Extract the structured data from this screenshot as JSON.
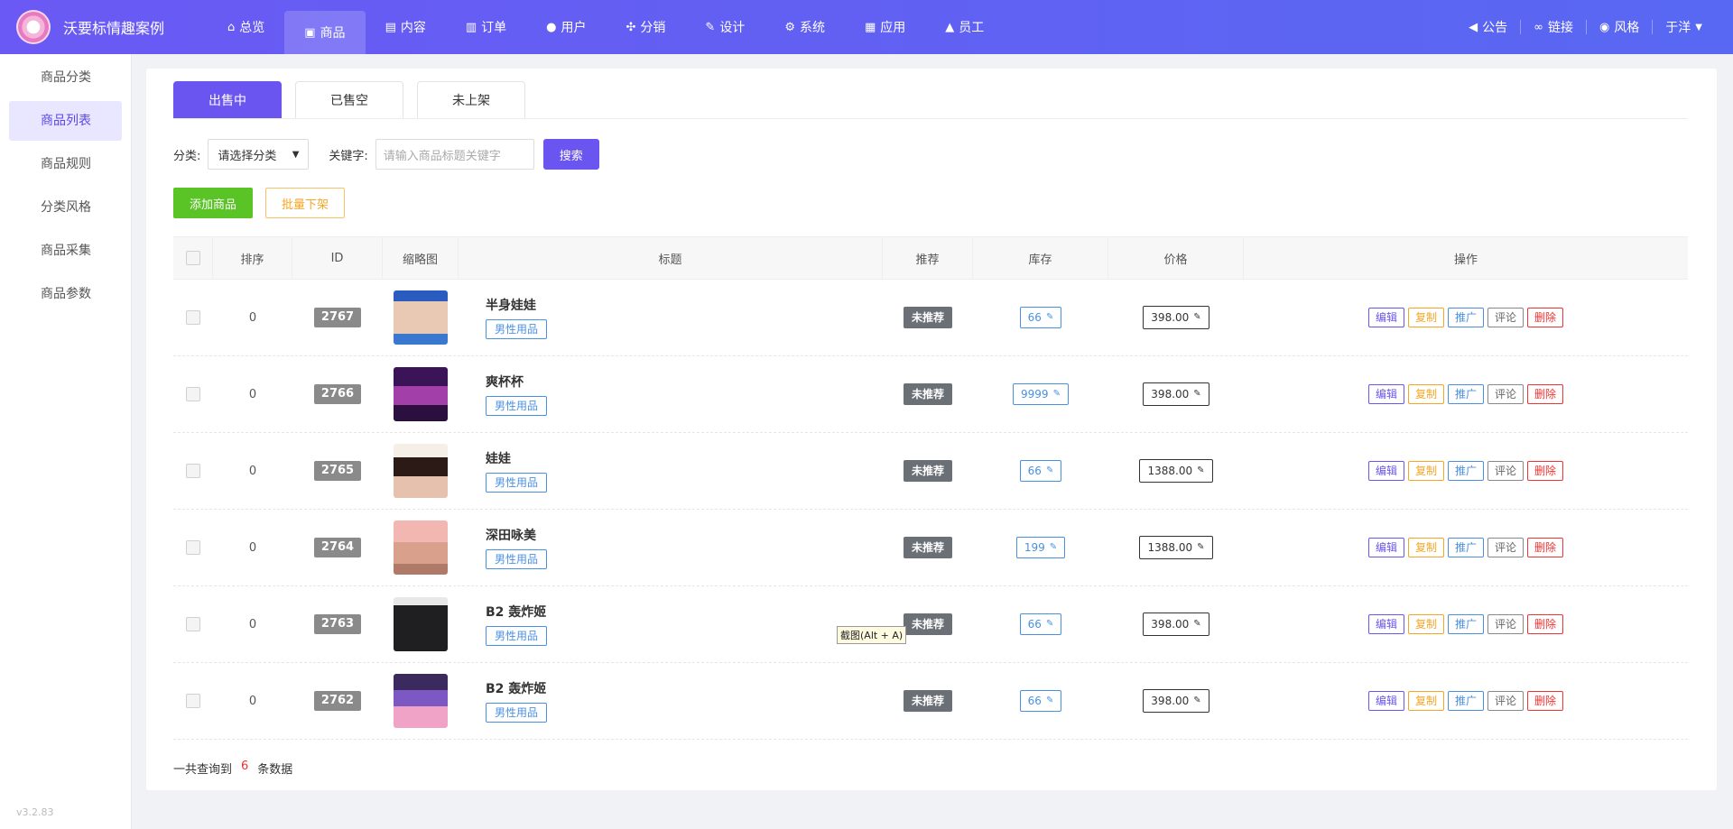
{
  "app": {
    "brand": "沃要标情趣案例",
    "version": "v3.2.83"
  },
  "topnav": {
    "items": [
      {
        "icon": "home-icon",
        "glyph": "⌂",
        "label": "总览"
      },
      {
        "icon": "shopping-bag-icon",
        "glyph": "▣",
        "label": "商品"
      },
      {
        "icon": "file-icon",
        "glyph": "▤",
        "label": "内容"
      },
      {
        "icon": "clipboard-icon",
        "glyph": "▥",
        "label": "订单"
      },
      {
        "icon": "user-icon",
        "glyph": "●",
        "label": "用户"
      },
      {
        "icon": "share-icon",
        "glyph": "✣",
        "label": "分销"
      },
      {
        "icon": "paint-icon",
        "glyph": "✎",
        "label": "设计"
      },
      {
        "icon": "gear-icon",
        "glyph": "⚙",
        "label": "系统"
      },
      {
        "icon": "apps-icon",
        "glyph": "▦",
        "label": "应用"
      },
      {
        "icon": "lock-icon",
        "glyph": "▲",
        "label": "员工"
      }
    ],
    "right": [
      {
        "icon": "megaphone-icon",
        "glyph": "◀",
        "label": "公告"
      },
      {
        "icon": "link-icon",
        "glyph": "∞",
        "label": "链接"
      },
      {
        "icon": "palette-icon",
        "glyph": "◉",
        "label": "风格"
      }
    ],
    "user": "于洋"
  },
  "sidebar": {
    "items": [
      {
        "label": "商品分类"
      },
      {
        "label": "商品列表"
      },
      {
        "label": "商品规则"
      },
      {
        "label": "分类风格"
      },
      {
        "label": "商品采集"
      },
      {
        "label": "商品参数"
      }
    ]
  },
  "tabs": [
    "出售中",
    "已售空",
    "未上架"
  ],
  "filters": {
    "category_label": "分类:",
    "category_value": "请选择分类",
    "keyword_label": "关键字:",
    "keyword_placeholder": "请输入商品标题关键字",
    "search_label": "搜索"
  },
  "actions": {
    "add_label": "添加商品",
    "batch_off_label": "批量下架"
  },
  "table": {
    "headers": [
      "排序",
      "ID",
      "缩略图",
      "标题",
      "推荐",
      "库存",
      "价格",
      "操作"
    ],
    "rows": [
      {
        "sort": "0",
        "id": "2767",
        "title": "半身娃娃",
        "tag": "男性用品",
        "rec": "未推荐",
        "stock": "66",
        "price": "398.00"
      },
      {
        "sort": "0",
        "id": "2766",
        "title": "爽杯杯",
        "tag": "男性用品",
        "rec": "未推荐",
        "stock": "9999",
        "price": "398.00"
      },
      {
        "sort": "0",
        "id": "2765",
        "title": "娃娃",
        "tag": "男性用品",
        "rec": "未推荐",
        "stock": "66",
        "price": "1388.00"
      },
      {
        "sort": "0",
        "id": "2764",
        "title": "深田咏美",
        "tag": "男性用品",
        "rec": "未推荐",
        "stock": "199",
        "price": "1388.00"
      },
      {
        "sort": "0",
        "id": "2763",
        "title": "B2 轰炸姬",
        "tag": "男性用品",
        "rec": "未推荐",
        "stock": "66",
        "price": "398.00"
      },
      {
        "sort": "0",
        "id": "2762",
        "title": "B2 轰炸姬",
        "tag": "男性用品",
        "rec": "未推荐",
        "stock": "66",
        "price": "398.00"
      }
    ],
    "ops": [
      "编辑",
      "复制",
      "推广",
      "评论",
      "删除"
    ]
  },
  "summary": {
    "prefix": "一共查询到",
    "count": "6",
    "suffix": "条数据"
  },
  "tooltip": "截图(Alt + A)"
}
